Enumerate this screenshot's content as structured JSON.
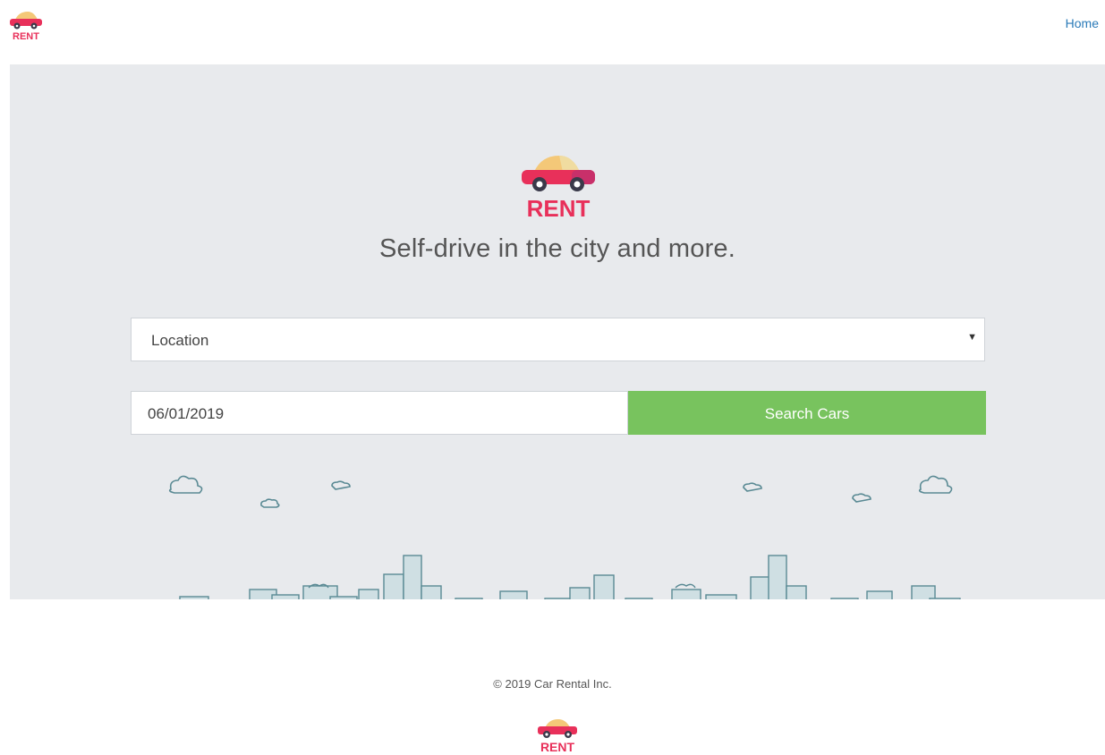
{
  "header": {
    "logo_text": "RENT",
    "nav_home": "Home"
  },
  "hero": {
    "logo_text": "RENT",
    "tagline": "Self-drive in the city and more.",
    "location_select": {
      "value": "Location",
      "caret": "▼"
    },
    "date_input": {
      "value": "06/01/2019"
    },
    "search_button": "Search Cars"
  },
  "footer": {
    "copyright": "© 2019 Car Rental Inc.",
    "logo_text": "RENT"
  },
  "colors": {
    "brand_pink": "#e8305a",
    "car_roof": "#f4c878",
    "car_body": "#c8306a",
    "accent_green": "#78c35e",
    "hero_bg": "#e8eaed",
    "link_blue": "#2a7ab8"
  }
}
